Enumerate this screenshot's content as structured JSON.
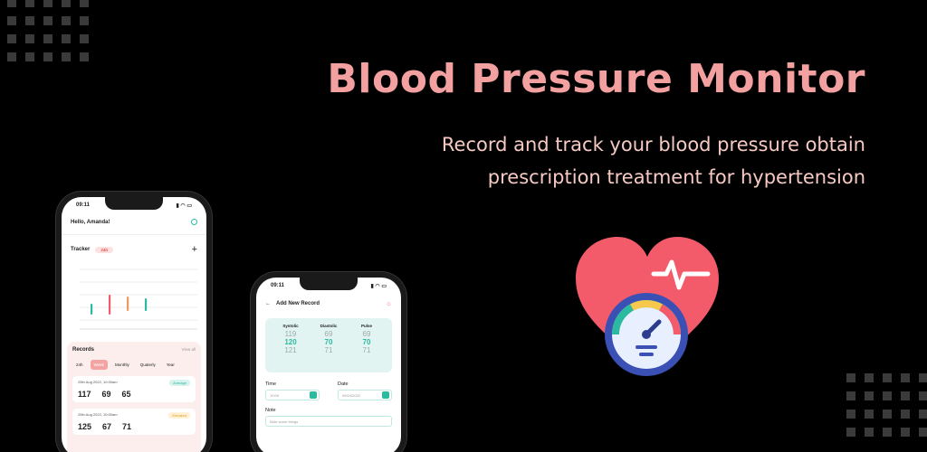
{
  "hero": {
    "title": "Blood Pressure Monitor",
    "subtitle": "Record and track your blood pressure obtain prescription treatment for hypertension"
  },
  "colors": {
    "accent": "#f2a0a0",
    "teal": "#2bb9a0",
    "heart": "#f35a6a"
  },
  "phone1": {
    "time": "09:11",
    "greeting": "Hello, Amanda!",
    "tracker": {
      "label": "Tracker",
      "range": "24h"
    },
    "records": {
      "title": "Records",
      "view_all": "View all",
      "filters": [
        "24h",
        "Week",
        "Monthly",
        "Quaterly",
        "Year"
      ],
      "items": [
        {
          "date": "25th Aug 2022, 10:00am",
          "status": "Average",
          "systolic": "117",
          "diastolic": "69",
          "pulse": "65"
        },
        {
          "date": "25th Aug 2022, 10:00am",
          "status": "Elevated",
          "systolic": "125",
          "diastolic": "67",
          "pulse": "71"
        }
      ]
    }
  },
  "phone2": {
    "time": "09:11",
    "title": "Add New Record",
    "picker": {
      "columns": [
        {
          "label": "Systolic",
          "values": [
            "119",
            "120",
            "121"
          ]
        },
        {
          "label": "Diastolic",
          "values": [
            "69",
            "70",
            "71"
          ]
        },
        {
          "label": "Pulse",
          "values": [
            "69",
            "70",
            "71"
          ]
        }
      ]
    },
    "time_label": "Time",
    "time_value": "10:00",
    "date_label": "Date",
    "date_value": "09/24/2022",
    "note_label": "Note",
    "note_placeholder": "Note some things"
  }
}
